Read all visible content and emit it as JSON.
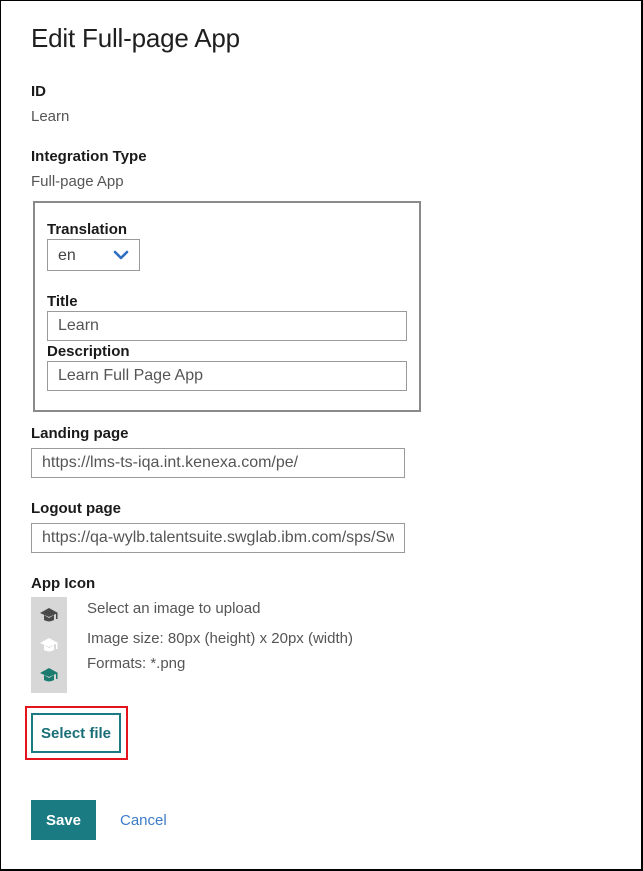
{
  "page": {
    "title": "Edit Full-page App"
  },
  "fields": {
    "id": {
      "label": "ID",
      "value": "Learn"
    },
    "integration_type": {
      "label": "Integration Type",
      "value": "Full-page App"
    },
    "translation": {
      "label": "Translation",
      "selected": "en",
      "icon": "chevron-down-icon"
    },
    "title": {
      "label": "Title",
      "value": "Learn"
    },
    "description": {
      "label": "Description",
      "value": "Learn Full Page App"
    },
    "landing_page": {
      "label": "Landing page",
      "value": "https://lms-ts-iqa.int.kenexa.com/pe/"
    },
    "logout_page": {
      "label": "Logout page",
      "value": "https://qa-wylb.talentsuite.swglab.ibm.com/sps/Sw"
    }
  },
  "app_icon": {
    "label": "App Icon",
    "previews": [
      {
        "icon": "graduation-cap-icon",
        "color": "#4a4a4a"
      },
      {
        "icon": "graduation-cap-icon",
        "color": "#ffffff"
      },
      {
        "icon": "graduation-cap-icon",
        "color": "#1a7b6e"
      }
    ],
    "instructions": "Select an image to upload",
    "image_size": "Image size: 80px (height) x 20px (width)",
    "formats": "Formats: *.png",
    "select_file_label": "Select file"
  },
  "actions": {
    "save_label": "Save",
    "cancel_label": "Cancel"
  },
  "colors": {
    "accent": "#1a7b83",
    "link": "#3d7cc9",
    "highlight": "#e3141b"
  }
}
